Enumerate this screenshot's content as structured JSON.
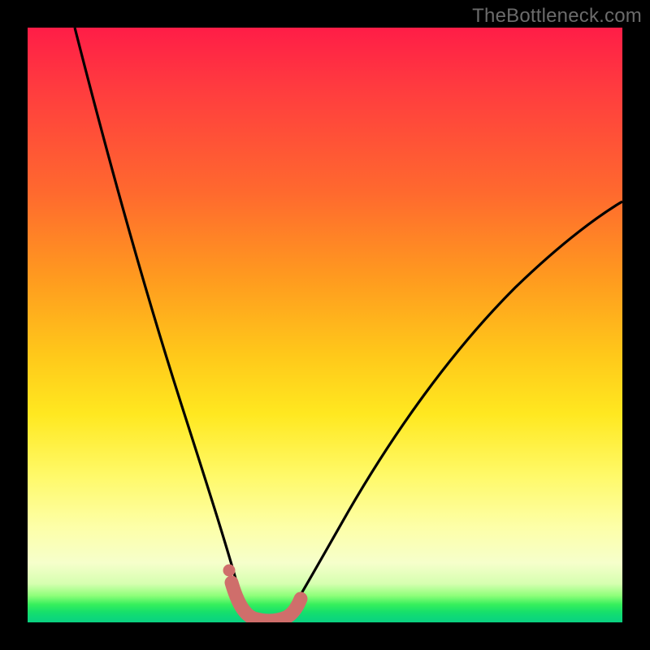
{
  "watermark": "TheBottleneck.com",
  "chart_data": {
    "type": "line",
    "title": "",
    "xlabel": "",
    "ylabel": "",
    "xlim": [
      0,
      100
    ],
    "ylim": [
      0,
      100
    ],
    "series": [
      {
        "name": "bottleneck-curve-left",
        "x": [
          8,
          12,
          16,
          20,
          24,
          27,
          30,
          32,
          34,
          35.5,
          36.5
        ],
        "y": [
          100,
          82,
          66,
          51,
          38,
          28,
          19,
          12,
          7,
          3.5,
          1.5
        ]
      },
      {
        "name": "bottleneck-curve-right",
        "x": [
          43,
          45,
          48,
          52,
          57,
          63,
          70,
          78,
          87,
          96,
          100
        ],
        "y": [
          1.5,
          4,
          9,
          16,
          24,
          33,
          42,
          51,
          59,
          66,
          69
        ]
      },
      {
        "name": "highlight-band",
        "x": [
          34,
          35,
          36,
          37.5,
          39.5,
          41.5,
          43,
          44
        ],
        "y": [
          7.5,
          3.5,
          1.5,
          0.8,
          0.8,
          1.2,
          2.2,
          4.2
        ]
      }
    ],
    "highlight_dot": {
      "x": 34,
      "y": 7.5
    },
    "colors": {
      "curve": "#000000",
      "highlight": "#cf6e6b",
      "gradient_top": "#ff1d47",
      "gradient_mid": "#ffe820",
      "gradient_bottom": "#0ad181"
    }
  }
}
